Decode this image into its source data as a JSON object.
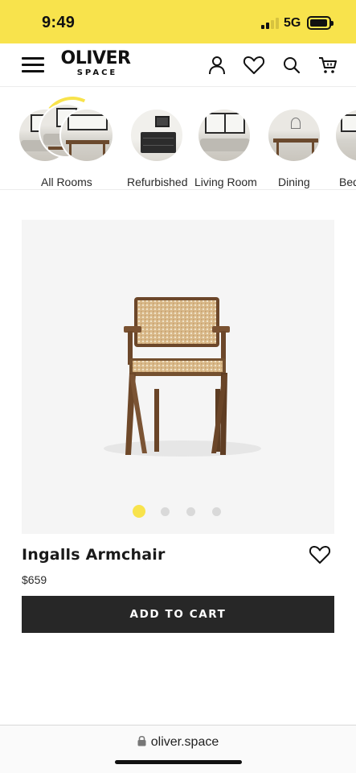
{
  "status_bar": {
    "time": "9:49",
    "network": "5G"
  },
  "header": {
    "logo_main": "OLIVER",
    "logo_sub": "SPACE",
    "icons": [
      "menu-icon",
      "account-icon",
      "heart-icon",
      "search-icon",
      "cart-icon"
    ]
  },
  "categories": [
    {
      "label": "All Rooms"
    },
    {
      "label": "Refurbished"
    },
    {
      "label": "Living Room"
    },
    {
      "label": "Dining"
    },
    {
      "label": "Bed"
    }
  ],
  "product": {
    "name": "Ingalls Armchair",
    "price": "$659",
    "cta": "ADD TO CART",
    "image_count": 4,
    "active_image": 1
  },
  "browser": {
    "url": "oliver.space"
  },
  "colors": {
    "brand_yellow": "#f8e34c",
    "button_dark": "#272727",
    "text_dark": "#1a1a1a"
  }
}
